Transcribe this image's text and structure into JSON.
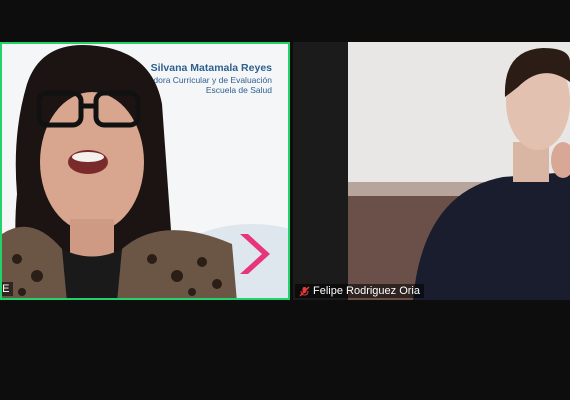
{
  "participants": [
    {
      "name_tag": "LE",
      "active_speaker": true,
      "banner": {
        "name": "Silvana Matamala Reyes",
        "role": "nadora Curricular y de Evaluación",
        "department": "Escuela de Salud"
      },
      "brand_color": "#e8357a",
      "text_color": "#2f5f8d",
      "border_color": "#22d26a"
    },
    {
      "name_tag": "Felipe Rodriguez Oria",
      "muted": true,
      "mute_icon": "mic-off-icon",
      "mute_color": "#e23b3b"
    }
  ],
  "layout": "gallery-view",
  "background_color": "#0d0d0d"
}
